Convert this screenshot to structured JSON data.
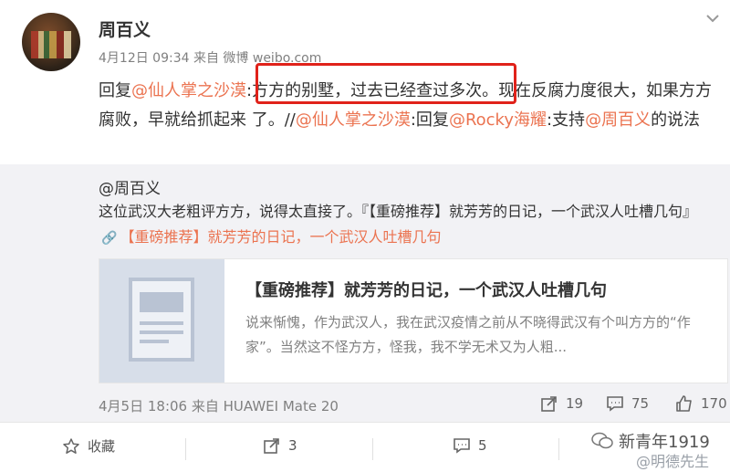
{
  "author": {
    "name": "周百义",
    "meta": "4月12日 09:34 来自 微博 weibo.com"
  },
  "post": {
    "prefix": "回复",
    "mention1": "@仙人掌之沙漠",
    "text1": ":方方的别墅，过去已经查过多次。现在反腐力度很大，如果方方腐败，早就给抓起来 了。//",
    "mention2": "@仙人掌之沙漠",
    "text2": ":回复",
    "mention3": "@Rocky海耀",
    "text3": ":支持",
    "mention4": "@周百义",
    "text4": "的说法"
  },
  "repost": {
    "user": "@周百义",
    "text": "这位武汉大老粗评方方，说得太直接了。『【重磅推荐】就芳芳的日记，一个武汉人吐槽几句』",
    "link_text": "【重磅推荐】就芳芳的日记，一个武汉人吐槽几句",
    "card": {
      "title": "【重磅推荐】就芳芳的日记，一个武汉人吐槽几句",
      "desc": "说来惭愧，作为武汉人，我在武汉疫情之前从不晓得武汉有个叫方方的“作家”。当然这不怪方方，怪我，我不学无术又为人粗..."
    },
    "time": "4月5日 18:06 来自 HUAWEI Mate 20",
    "forwards": "19",
    "comments": "75",
    "likes": "170"
  },
  "actions": {
    "favorite": "收藏",
    "forward": "3",
    "comment": "5"
  },
  "watermark": {
    "line1": "新青年1919",
    "line2": "@明德先生"
  },
  "colors": {
    "link": "#eb7350",
    "highlight": "#e0221a",
    "repost_bg": "#f2f2f5"
  }
}
